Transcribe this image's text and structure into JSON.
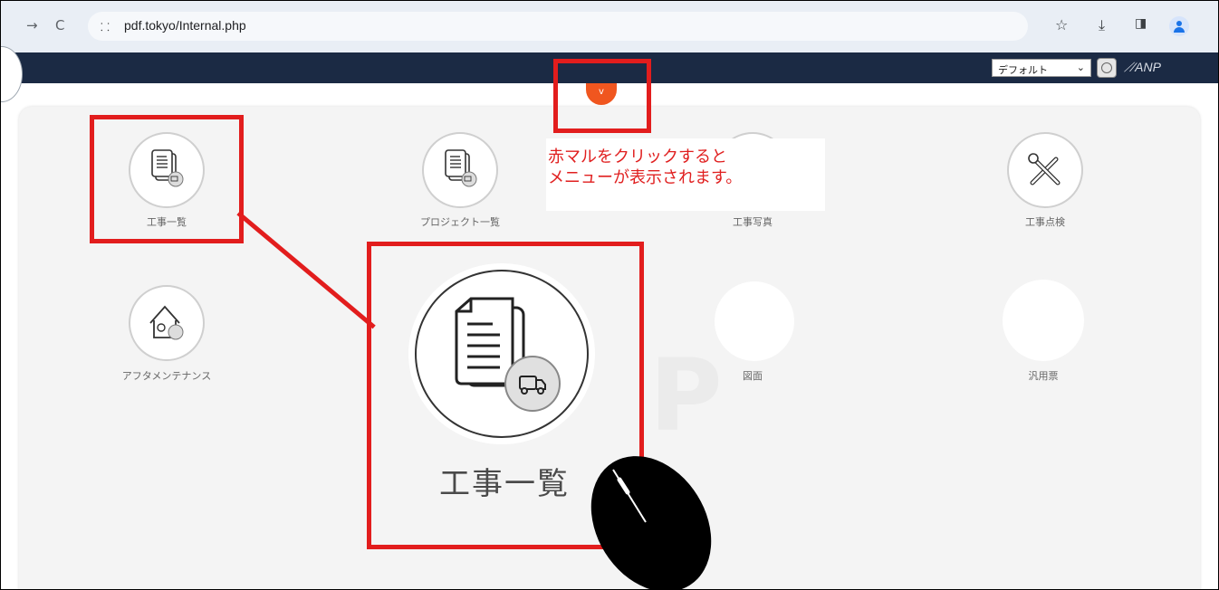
{
  "browser": {
    "url": "pdf.tokyo/Internal.php",
    "back_icon": "forward-arrow-icon",
    "reload_icon": "reload-icon"
  },
  "header": {
    "select_value": "デフォルト",
    "logo_text": "ANP"
  },
  "menu": {
    "toggle_label": "v",
    "tiles": [
      {
        "label": "工事一覧",
        "icon": "documents-truck-icon"
      },
      {
        "label": "プロジェクト一覧",
        "icon": "documents-truck-icon"
      },
      {
        "label": "工事写真",
        "icon": "photo-icon"
      },
      {
        "label": "工事点検",
        "icon": "tools-icon"
      },
      {
        "label": "アフタメンテナンス",
        "icon": "house-tools-icon"
      },
      {
        "label": "図面",
        "icon": "blank-icon"
      },
      {
        "label": "汎用票",
        "icon": "blank-icon"
      }
    ]
  },
  "annotation": {
    "callout_line1": "赤マルをクリックすると",
    "callout_line2": "メニューが表示されます。",
    "zoom_label": "工事一覧",
    "accent_color": "#e21d1d"
  }
}
